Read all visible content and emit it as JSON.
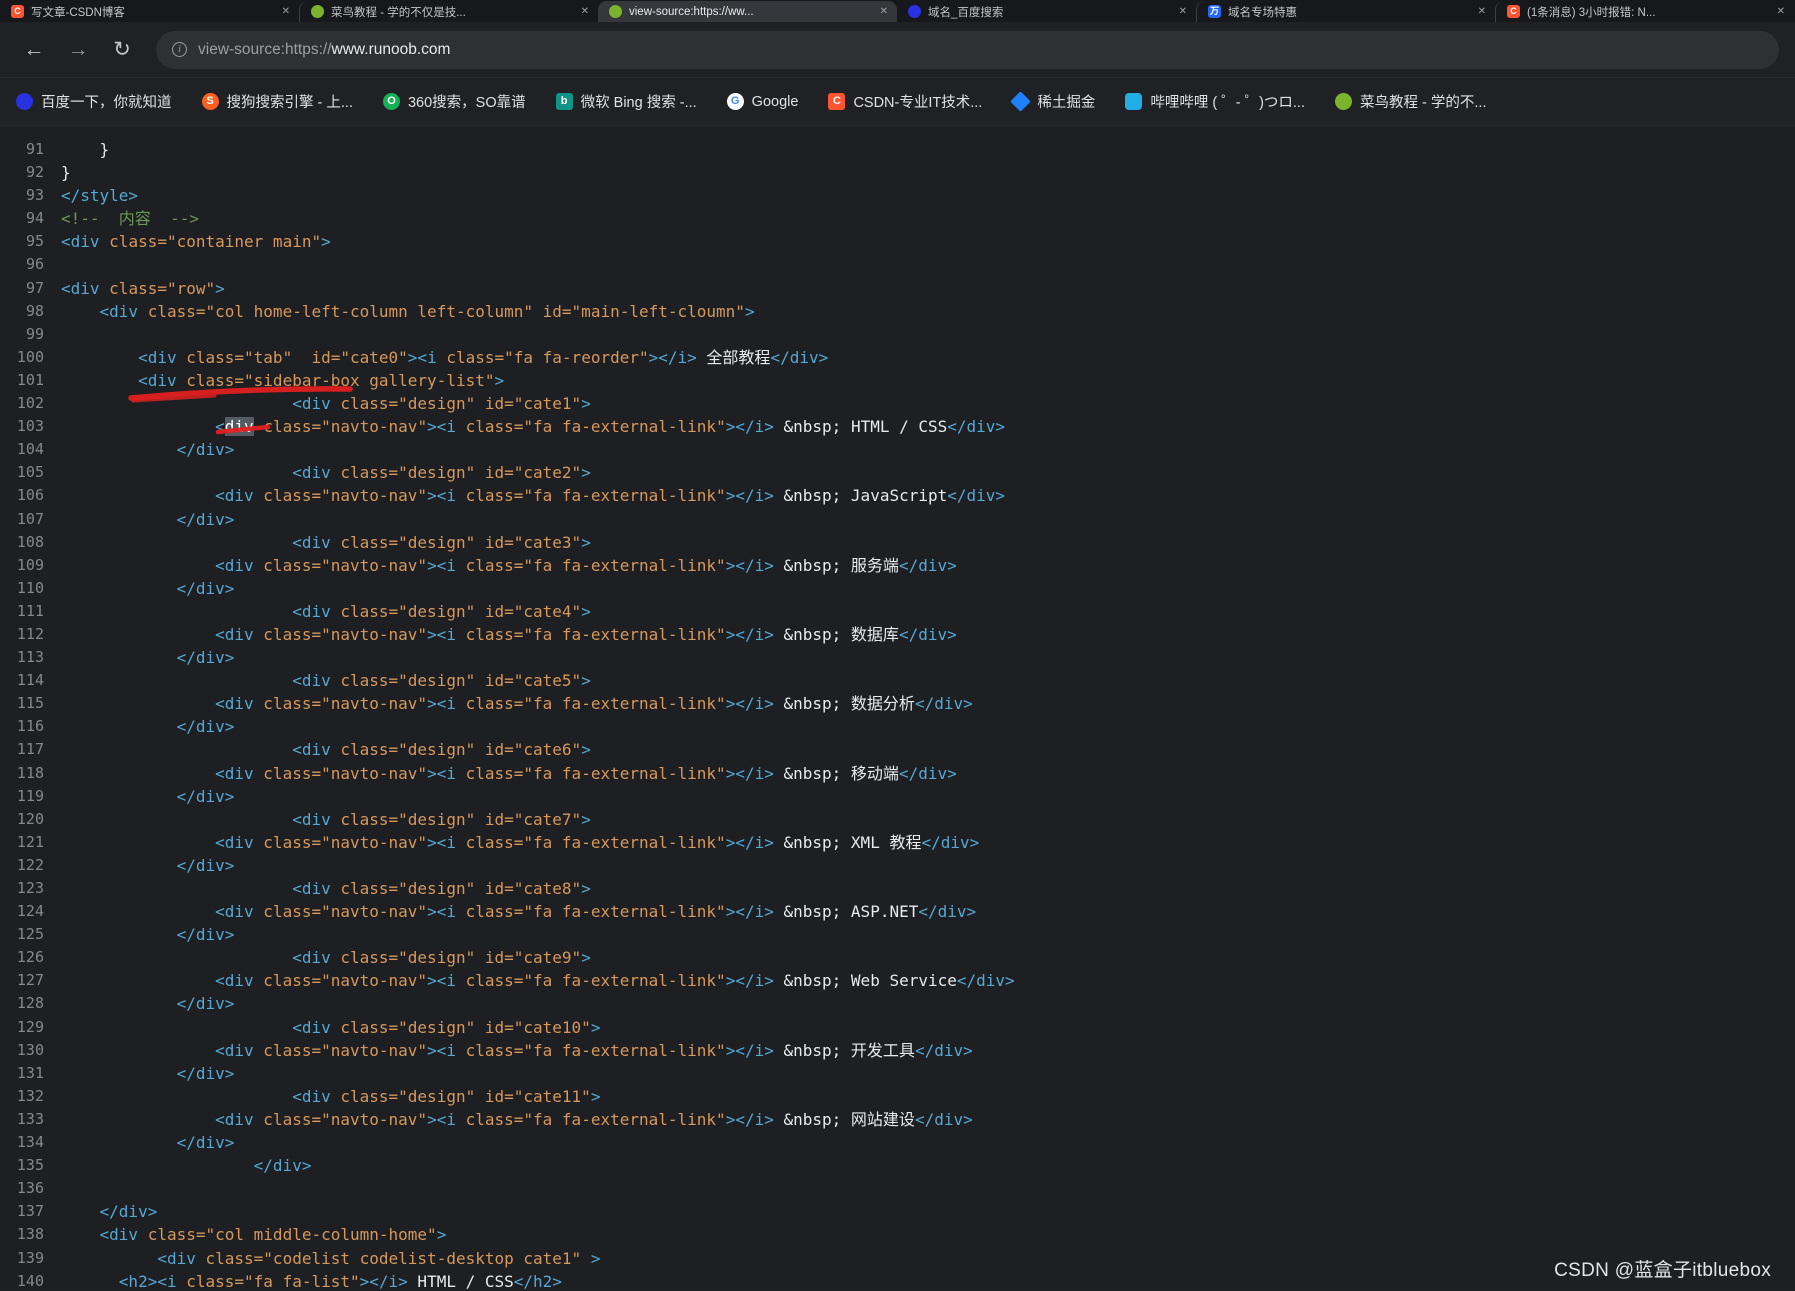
{
  "colors": {
    "tag": "#55a8d4",
    "attribute": "#d6985c",
    "comment": "#6a9955",
    "text": "#e8eaed",
    "red_marker": "#e32020",
    "selection_bg": "#545b64"
  },
  "browser": {
    "tabs": [
      {
        "title": "写文章-CSDN博客",
        "style": "csdn",
        "glyph": "C",
        "active": false
      },
      {
        "title": "菜鸟教程 - 学的不仅是技...",
        "style": "runoob",
        "glyph": "",
        "active": false
      },
      {
        "title": "view-source:https://ww...",
        "style": "runoob",
        "glyph": "",
        "active": true
      },
      {
        "title": "域名_百度搜索",
        "style": "baidu",
        "glyph": "",
        "active": false
      },
      {
        "title": "域名专场特惠",
        "style": "wanwang",
        "glyph": "万",
        "active": false
      },
      {
        "title": "(1条消息) 3小时报错: N...",
        "style": "csdn",
        "glyph": "C",
        "active": false
      }
    ],
    "address": {
      "prefix": "view-source:https://",
      "host": "www.runoob.com"
    },
    "bookmarks": [
      {
        "label": "百度一下，你就知道",
        "style": "baidu",
        "glyph": ""
      },
      {
        "label": "搜狗搜索引擎 - 上...",
        "style": "sogou",
        "glyph": "S"
      },
      {
        "label": "360搜索，SO靠谱",
        "style": "so360",
        "glyph": "O"
      },
      {
        "label": "微软 Bing 搜索 -...",
        "style": "bing",
        "glyph": "b"
      },
      {
        "label": "Google",
        "style": "google",
        "glyph": "G"
      },
      {
        "label": "CSDN-专业IT技术...",
        "style": "csdn",
        "glyph": "C"
      },
      {
        "label": "稀土掘金",
        "style": "juejin",
        "glyph": ""
      },
      {
        "label": "哔哩哔哩 ( ゜- ゜)つロ...",
        "style": "bili",
        "glyph": ""
      },
      {
        "label": "菜鸟教程 - 学的不...",
        "style": "runoob",
        "glyph": ""
      }
    ]
  },
  "source": {
    "lines": [
      [
        91,
        [
          [
            "p",
            "    }"
          ]
        ]
      ],
      [
        92,
        [
          [
            "p",
            "}"
          ]
        ]
      ],
      [
        93,
        [
          [
            "t",
            "</style>"
          ]
        ]
      ],
      [
        94,
        [
          [
            "c",
            "<!--  内容  -->"
          ]
        ]
      ],
      [
        95,
        [
          [
            "t",
            "<div "
          ],
          [
            "a",
            "class=\"container main\""
          ],
          [
            "t",
            ">"
          ]
        ]
      ],
      [
        96,
        []
      ],
      [
        97,
        [
          [
            "t",
            "<div "
          ],
          [
            "a",
            "class=\"row\""
          ],
          [
            "t",
            ">"
          ]
        ]
      ],
      [
        98,
        [
          [
            "p",
            "    "
          ],
          [
            "t",
            "<div "
          ],
          [
            "a",
            "class=\"col home-left-column left-column\" id=\"main-left-cloumn\""
          ],
          [
            "t",
            ">"
          ]
        ]
      ],
      [
        99,
        []
      ],
      [
        100,
        [
          [
            "p",
            "        "
          ],
          [
            "t",
            "<div "
          ],
          [
            "a",
            "class=\"tab\"  id=\"cate0\""
          ],
          [
            "t",
            "><i "
          ],
          [
            "a",
            "class=\"fa fa-reorder\""
          ],
          [
            "t",
            "></i>"
          ],
          [
            "x",
            " 全部教程"
          ],
          [
            "t",
            "</div>"
          ]
        ]
      ],
      [
        101,
        [
          [
            "p",
            "        "
          ],
          [
            "t",
            "<div "
          ],
          [
            "a",
            "class=\"sidebar-box gallery-list\""
          ],
          [
            "t",
            ">"
          ]
        ]
      ],
      [
        102,
        [
          [
            "p",
            "                        "
          ],
          [
            "t",
            "<div "
          ],
          [
            "a",
            "class=\"design\" id=\"cate1\""
          ],
          [
            "t",
            ">"
          ]
        ]
      ],
      [
        103,
        [
          [
            "p",
            "                "
          ],
          [
            "t",
            "<"
          ],
          [
            "s",
            "div"
          ],
          [
            "t",
            " "
          ],
          [
            "a",
            "class=\"navto-nav\""
          ],
          [
            "t",
            "><i "
          ],
          [
            "a",
            "class=\"fa fa-external-link\""
          ],
          [
            "t",
            "></i>"
          ],
          [
            "x",
            " &nbsp; HTML / CSS"
          ],
          [
            "t",
            "</div>"
          ]
        ]
      ],
      [
        104,
        [
          [
            "p",
            "            "
          ],
          [
            "t",
            "</div>"
          ]
        ]
      ],
      [
        105,
        [
          [
            "p",
            "                        "
          ],
          [
            "t",
            "<div "
          ],
          [
            "a",
            "class=\"design\" id=\"cate2\""
          ],
          [
            "t",
            ">"
          ]
        ]
      ],
      [
        106,
        [
          [
            "p",
            "                "
          ],
          [
            "t",
            "<div "
          ],
          [
            "a",
            "class=\"navto-nav\""
          ],
          [
            "t",
            "><i "
          ],
          [
            "a",
            "class=\"fa fa-external-link\""
          ],
          [
            "t",
            "></i>"
          ],
          [
            "x",
            " &nbsp; JavaScript"
          ],
          [
            "t",
            "</div>"
          ]
        ]
      ],
      [
        107,
        [
          [
            "p",
            "            "
          ],
          [
            "t",
            "</div>"
          ]
        ]
      ],
      [
        108,
        [
          [
            "p",
            "                        "
          ],
          [
            "t",
            "<div "
          ],
          [
            "a",
            "class=\"design\" id=\"cate3\""
          ],
          [
            "t",
            ">"
          ]
        ]
      ],
      [
        109,
        [
          [
            "p",
            "                "
          ],
          [
            "t",
            "<div "
          ],
          [
            "a",
            "class=\"navto-nav\""
          ],
          [
            "t",
            "><i "
          ],
          [
            "a",
            "class=\"fa fa-external-link\""
          ],
          [
            "t",
            "></i>"
          ],
          [
            "x",
            " &nbsp; 服务端"
          ],
          [
            "t",
            "</div>"
          ]
        ]
      ],
      [
        110,
        [
          [
            "p",
            "            "
          ],
          [
            "t",
            "</div>"
          ]
        ]
      ],
      [
        111,
        [
          [
            "p",
            "                        "
          ],
          [
            "t",
            "<div "
          ],
          [
            "a",
            "class=\"design\" id=\"cate4\""
          ],
          [
            "t",
            ">"
          ]
        ]
      ],
      [
        112,
        [
          [
            "p",
            "                "
          ],
          [
            "t",
            "<div "
          ],
          [
            "a",
            "class=\"navto-nav\""
          ],
          [
            "t",
            "><i "
          ],
          [
            "a",
            "class=\"fa fa-external-link\""
          ],
          [
            "t",
            "></i>"
          ],
          [
            "x",
            " &nbsp; 数据库"
          ],
          [
            "t",
            "</div>"
          ]
        ]
      ],
      [
        113,
        [
          [
            "p",
            "            "
          ],
          [
            "t",
            "</div>"
          ]
        ]
      ],
      [
        114,
        [
          [
            "p",
            "                        "
          ],
          [
            "t",
            "<div "
          ],
          [
            "a",
            "class=\"design\" id=\"cate5\""
          ],
          [
            "t",
            ">"
          ]
        ]
      ],
      [
        115,
        [
          [
            "p",
            "                "
          ],
          [
            "t",
            "<div "
          ],
          [
            "a",
            "class=\"navto-nav\""
          ],
          [
            "t",
            "><i "
          ],
          [
            "a",
            "class=\"fa fa-external-link\""
          ],
          [
            "t",
            "></i>"
          ],
          [
            "x",
            " &nbsp; 数据分析"
          ],
          [
            "t",
            "</div>"
          ]
        ]
      ],
      [
        116,
        [
          [
            "p",
            "            "
          ],
          [
            "t",
            "</div>"
          ]
        ]
      ],
      [
        117,
        [
          [
            "p",
            "                        "
          ],
          [
            "t",
            "<div "
          ],
          [
            "a",
            "class=\"design\" id=\"cate6\""
          ],
          [
            "t",
            ">"
          ]
        ]
      ],
      [
        118,
        [
          [
            "p",
            "                "
          ],
          [
            "t",
            "<div "
          ],
          [
            "a",
            "class=\"navto-nav\""
          ],
          [
            "t",
            "><i "
          ],
          [
            "a",
            "class=\"fa fa-external-link\""
          ],
          [
            "t",
            "></i>"
          ],
          [
            "x",
            " &nbsp; 移动端"
          ],
          [
            "t",
            "</div>"
          ]
        ]
      ],
      [
        119,
        [
          [
            "p",
            "            "
          ],
          [
            "t",
            "</div>"
          ]
        ]
      ],
      [
        120,
        [
          [
            "p",
            "                        "
          ],
          [
            "t",
            "<div "
          ],
          [
            "a",
            "class=\"design\" id=\"cate7\""
          ],
          [
            "t",
            ">"
          ]
        ]
      ],
      [
        121,
        [
          [
            "p",
            "                "
          ],
          [
            "t",
            "<div "
          ],
          [
            "a",
            "class=\"navto-nav\""
          ],
          [
            "t",
            "><i "
          ],
          [
            "a",
            "class=\"fa fa-external-link\""
          ],
          [
            "t",
            "></i>"
          ],
          [
            "x",
            " &nbsp; XML 教程"
          ],
          [
            "t",
            "</div>"
          ]
        ]
      ],
      [
        122,
        [
          [
            "p",
            "            "
          ],
          [
            "t",
            "</div>"
          ]
        ]
      ],
      [
        123,
        [
          [
            "p",
            "                        "
          ],
          [
            "t",
            "<div "
          ],
          [
            "a",
            "class=\"design\" id=\"cate8\""
          ],
          [
            "t",
            ">"
          ]
        ]
      ],
      [
        124,
        [
          [
            "p",
            "                "
          ],
          [
            "t",
            "<div "
          ],
          [
            "a",
            "class=\"navto-nav\""
          ],
          [
            "t",
            "><i "
          ],
          [
            "a",
            "class=\"fa fa-external-link\""
          ],
          [
            "t",
            "></i>"
          ],
          [
            "x",
            " &nbsp; ASP.NET"
          ],
          [
            "t",
            "</div>"
          ]
        ]
      ],
      [
        125,
        [
          [
            "p",
            "            "
          ],
          [
            "t",
            "</div>"
          ]
        ]
      ],
      [
        126,
        [
          [
            "p",
            "                        "
          ],
          [
            "t",
            "<div "
          ],
          [
            "a",
            "class=\"design\" id=\"cate9\""
          ],
          [
            "t",
            ">"
          ]
        ]
      ],
      [
        127,
        [
          [
            "p",
            "                "
          ],
          [
            "t",
            "<div "
          ],
          [
            "a",
            "class=\"navto-nav\""
          ],
          [
            "t",
            "><i "
          ],
          [
            "a",
            "class=\"fa fa-external-link\""
          ],
          [
            "t",
            "></i>"
          ],
          [
            "x",
            " &nbsp; Web Service"
          ],
          [
            "t",
            "</div>"
          ]
        ]
      ],
      [
        128,
        [
          [
            "p",
            "            "
          ],
          [
            "t",
            "</div>"
          ]
        ]
      ],
      [
        129,
        [
          [
            "p",
            "                        "
          ],
          [
            "t",
            "<div "
          ],
          [
            "a",
            "class=\"design\" id=\"cate10\""
          ],
          [
            "t",
            ">"
          ]
        ]
      ],
      [
        130,
        [
          [
            "p",
            "                "
          ],
          [
            "t",
            "<div "
          ],
          [
            "a",
            "class=\"navto-nav\""
          ],
          [
            "t",
            "><i "
          ],
          [
            "a",
            "class=\"fa fa-external-link\""
          ],
          [
            "t",
            "></i>"
          ],
          [
            "x",
            " &nbsp; 开发工具"
          ],
          [
            "t",
            "</div>"
          ]
        ]
      ],
      [
        131,
        [
          [
            "p",
            "            "
          ],
          [
            "t",
            "</div>"
          ]
        ]
      ],
      [
        132,
        [
          [
            "p",
            "                        "
          ],
          [
            "t",
            "<div "
          ],
          [
            "a",
            "class=\"design\" id=\"cate11\""
          ],
          [
            "t",
            ">"
          ]
        ]
      ],
      [
        133,
        [
          [
            "p",
            "                "
          ],
          [
            "t",
            "<div "
          ],
          [
            "a",
            "class=\"navto-nav\""
          ],
          [
            "t",
            "><i "
          ],
          [
            "a",
            "class=\"fa fa-external-link\""
          ],
          [
            "t",
            "></i>"
          ],
          [
            "x",
            " &nbsp; 网站建设"
          ],
          [
            "t",
            "</div>"
          ]
        ]
      ],
      [
        134,
        [
          [
            "p",
            "            "
          ],
          [
            "t",
            "</div>"
          ]
        ]
      ],
      [
        135,
        [
          [
            "p",
            "                    "
          ],
          [
            "t",
            "</div>"
          ]
        ]
      ],
      [
        136,
        []
      ],
      [
        137,
        [
          [
            "p",
            "    "
          ],
          [
            "t",
            "</div>"
          ]
        ]
      ],
      [
        138,
        [
          [
            "p",
            "    "
          ],
          [
            "t",
            "<div "
          ],
          [
            "a",
            "class=\"col middle-column-home\""
          ],
          [
            "t",
            ">"
          ]
        ]
      ],
      [
        139,
        [
          [
            "p",
            "          "
          ],
          [
            "t",
            "<div "
          ],
          [
            "a",
            "class=\"codelist codelist-desktop cate1\""
          ],
          [
            "t",
            " >"
          ]
        ]
      ],
      [
        140,
        [
          [
            "p",
            "      "
          ],
          [
            "t",
            "<h2><i "
          ],
          [
            "a",
            "class=\"fa fa-list\""
          ],
          [
            "t",
            "></i>"
          ],
          [
            "x",
            " HTML / CSS"
          ],
          [
            "t",
            "</h2>"
          ]
        ]
      ]
    ]
  },
  "watermark": "CSDN @蓝盒子itbluebox"
}
